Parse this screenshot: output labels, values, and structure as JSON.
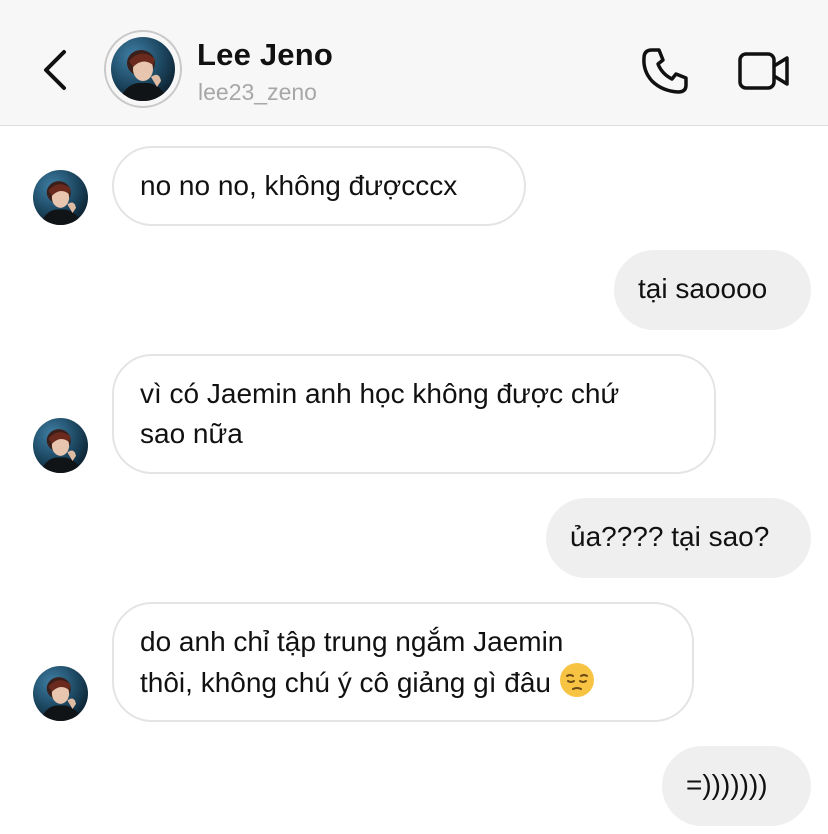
{
  "header": {
    "back_icon": "chevron-left-icon",
    "name": "Lee Jeno",
    "username": "lee23_zeno",
    "call_icon": "phone-icon",
    "video_icon": "video-camera-icon"
  },
  "colors": {
    "header_bg": "#f7f7f7",
    "incoming_bubble_bg": "#ffffff",
    "incoming_bubble_border": "#e4e4e4",
    "outgoing_bubble_bg": "#efefef",
    "username_gray": "#a7a7a7"
  },
  "messages": [
    {
      "from": "them",
      "text": "no no no, không đượcccx"
    },
    {
      "from": "me",
      "text": "tại saoooo"
    },
    {
      "from": "them",
      "text": "vì có Jaemin anh học không được chứ\nsao nữa"
    },
    {
      "from": "me",
      "text": "ủa???? tại sao?"
    },
    {
      "from": "them",
      "text": "do anh chỉ tập trung ngắm Jaemin\nthôi, không chú ý cô giảng gì đâu",
      "emoji": "pensive-face-emoji"
    },
    {
      "from": "me",
      "text": "=)))))))"
    }
  ]
}
